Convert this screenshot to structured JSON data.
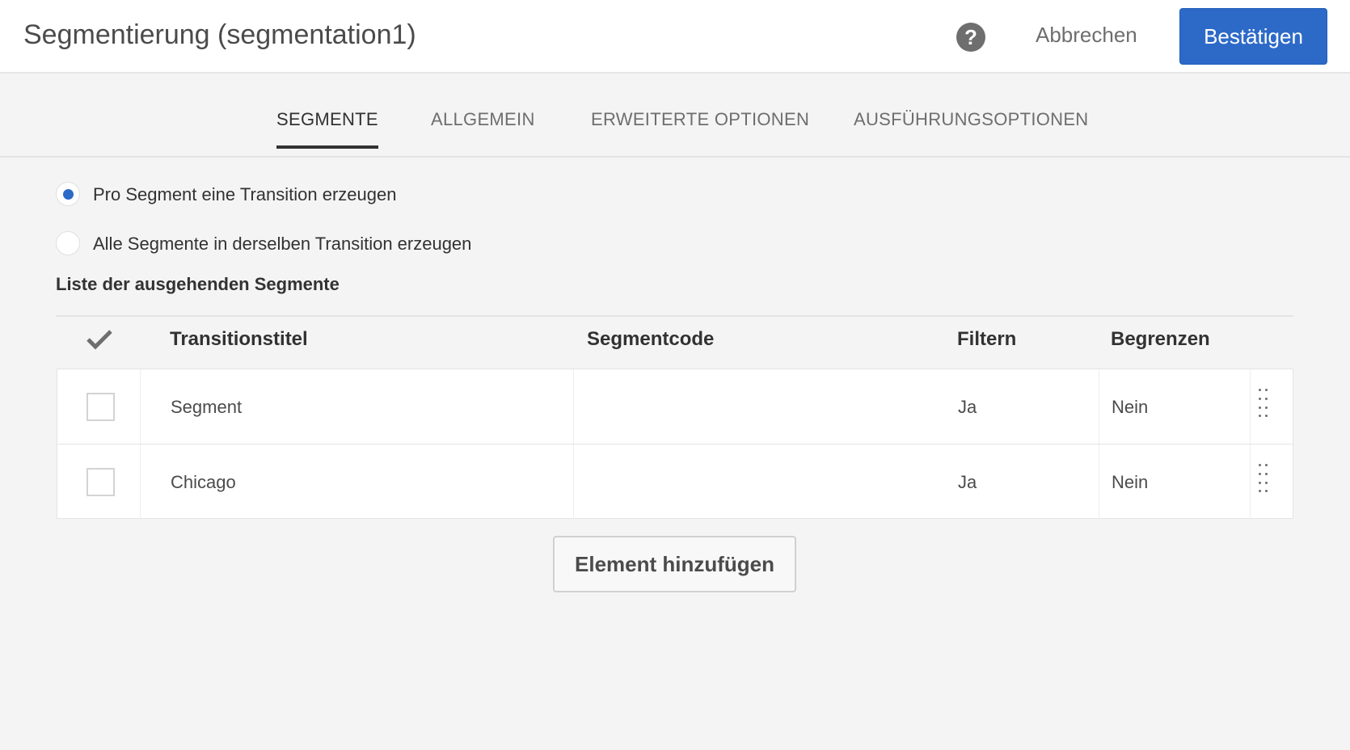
{
  "header": {
    "title": "Segmentierung (segmentation1)",
    "help_icon": "question-circle-icon",
    "cancel": "Abbrechen",
    "confirm": "Bestätigen"
  },
  "tabs": [
    "SEGMENTE",
    "ALLGEMEIN",
    "ERWEITERTE OPTIONEN",
    "AUSFÜHRUNGSOPTIONEN"
  ],
  "active_tab": "SEGMENTE",
  "options": [
    {
      "label": "Pro Segment eine Transition erzeugen",
      "selected": true
    },
    {
      "label": "Alle Segmente in derselben Transition erzeugen",
      "selected": false
    }
  ],
  "list": {
    "heading": "Liste der ausgehenden Segmente",
    "columns": [
      "Transitionstitel",
      "Segmentcode",
      "Filtern",
      "Begrenzen"
    ],
    "rows": [
      {
        "title": "Segment",
        "code": "",
        "filter": "Ja",
        "limit": "Nein"
      },
      {
        "title": "Chicago",
        "code": "",
        "filter": "Ja",
        "limit": "Nein"
      }
    ],
    "add": "Element hinzufügen"
  },
  "colors": {
    "accent": "#2d6ac8"
  }
}
